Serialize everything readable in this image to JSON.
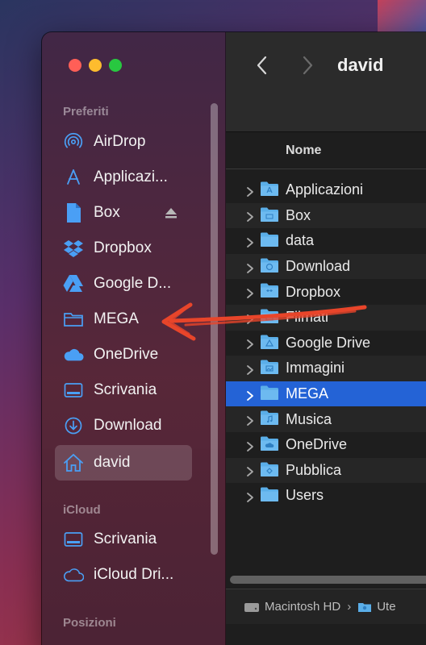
{
  "window": {
    "title": "david"
  },
  "sidebar": {
    "sections": {
      "favorites": "Preferiti",
      "icloud": "iCloud",
      "locations": "Posizioni"
    },
    "favorites": [
      {
        "label": "AirDrop",
        "icon": "airdrop-icon"
      },
      {
        "label": "Applicazi...",
        "icon": "applications-icon"
      },
      {
        "label": "Box",
        "icon": "document-icon",
        "ejectable": true
      },
      {
        "label": "Dropbox",
        "icon": "dropbox-icon"
      },
      {
        "label": "Google D...",
        "icon": "google-drive-icon"
      },
      {
        "label": "MEGA",
        "icon": "folder-icon"
      },
      {
        "label": "OneDrive",
        "icon": "cloud-icon"
      },
      {
        "label": "Scrivania",
        "icon": "desktop-icon"
      },
      {
        "label": "Download",
        "icon": "download-icon"
      },
      {
        "label": "david",
        "icon": "home-icon",
        "selected": true
      }
    ],
    "icloud": [
      {
        "label": "Scrivania",
        "icon": "desktop-icon"
      },
      {
        "label": "iCloud Dri...",
        "icon": "icloud-icon"
      }
    ]
  },
  "main": {
    "column_name": "Nome",
    "rows": [
      {
        "label": "Applicazioni",
        "icon": "applications-folder-icon"
      },
      {
        "label": "Box",
        "icon": "box-folder-icon"
      },
      {
        "label": "data",
        "icon": "folder-icon"
      },
      {
        "label": "Download",
        "icon": "download-folder-icon"
      },
      {
        "label": "Dropbox",
        "icon": "dropbox-folder-icon"
      },
      {
        "label": "Filmati",
        "icon": "movies-folder-icon"
      },
      {
        "label": "Google Drive",
        "icon": "google-drive-folder-icon"
      },
      {
        "label": "Immagini",
        "icon": "pictures-folder-icon"
      },
      {
        "label": "MEGA",
        "icon": "folder-icon",
        "selected": true
      },
      {
        "label": "Musica",
        "icon": "music-folder-icon"
      },
      {
        "label": "OneDrive",
        "icon": "onedrive-folder-icon"
      },
      {
        "label": "Pubblica",
        "icon": "public-folder-icon"
      },
      {
        "label": "Users",
        "icon": "folder-icon"
      }
    ]
  },
  "pathbar": {
    "disk": "Macintosh HD",
    "separator": "›",
    "next": "Ute"
  },
  "colors": {
    "selection": "#2463d6",
    "folder": "#5aaee8",
    "sidebar_icon": "#4a9ff5",
    "annotation": "#e8452a"
  }
}
